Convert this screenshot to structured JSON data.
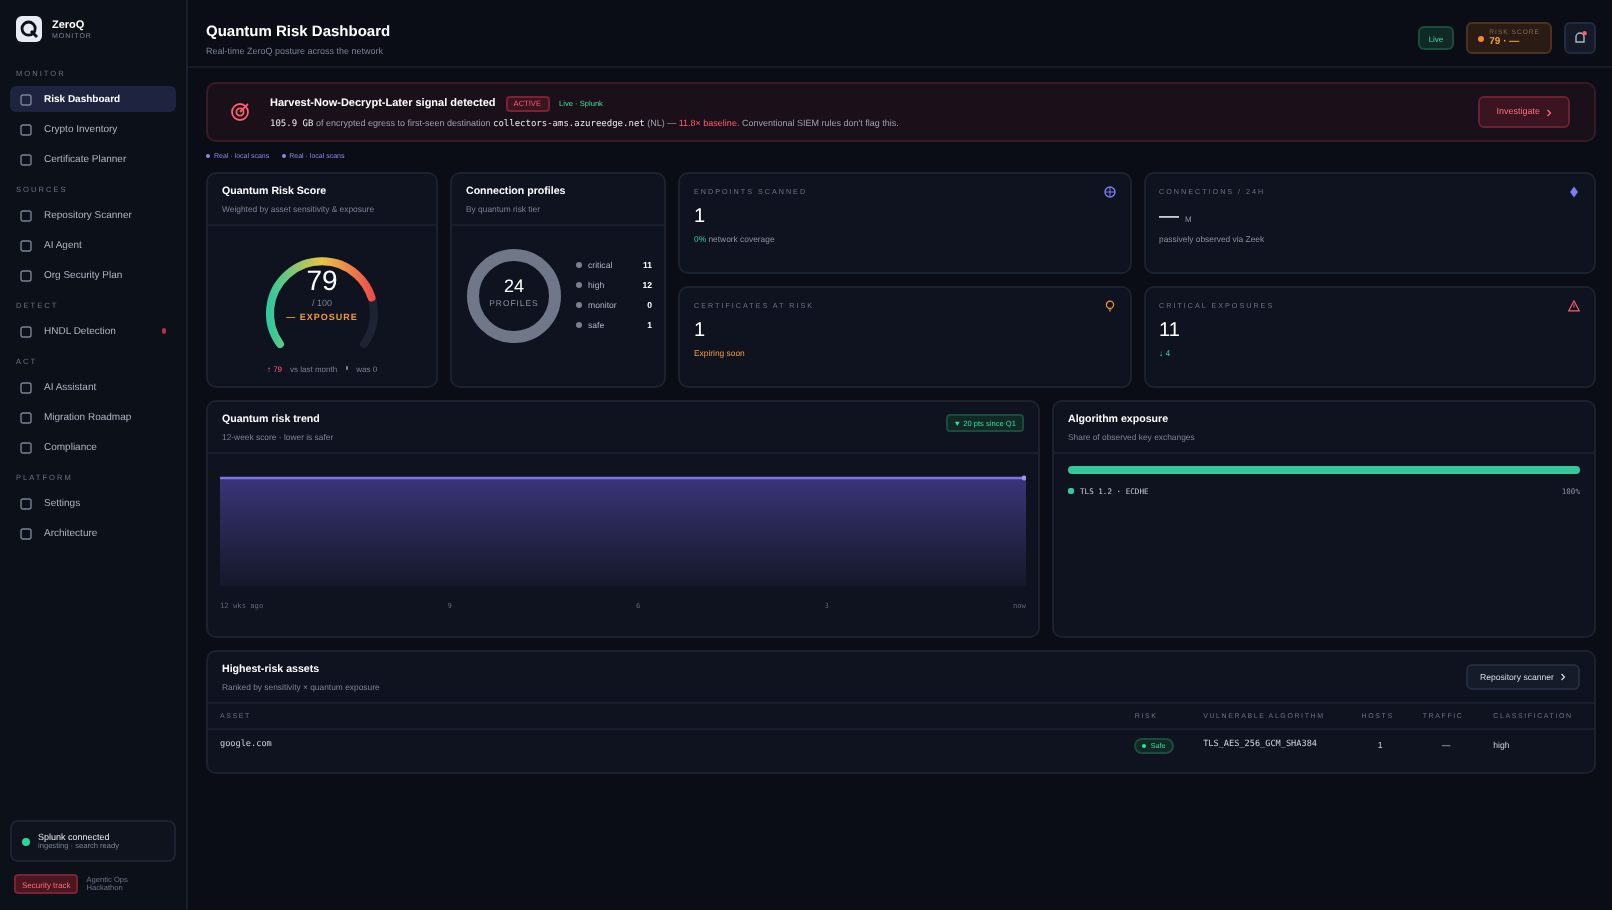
{
  "brand": {
    "name": "ZeroQ",
    "subtitle": "MONITOR"
  },
  "nav_sections": [
    {
      "title": "MONITOR",
      "items": [
        {
          "label": "Risk Dashboard",
          "selected": true,
          "alert": false
        },
        {
          "label": "Crypto Inventory",
          "selected": false,
          "alert": false
        },
        {
          "label": "Certificate Planner",
          "selected": false,
          "alert": false
        }
      ]
    },
    {
      "title": "SOURCES",
      "items": [
        {
          "label": "Repository Scanner",
          "selected": false,
          "alert": false
        },
        {
          "label": "AI Agent",
          "selected": false,
          "alert": false
        },
        {
          "label": "Org Security Plan",
          "selected": false,
          "alert": false
        }
      ]
    },
    {
      "title": "DETECT",
      "items": [
        {
          "label": "HNDL Detection",
          "selected": false,
          "alert": true
        }
      ]
    },
    {
      "title": "ACT",
      "items": [
        {
          "label": "AI Assistant",
          "selected": false,
          "alert": false
        },
        {
          "label": "Migration Roadmap",
          "selected": false,
          "alert": false
        },
        {
          "label": "Compliance",
          "selected": false,
          "alert": false
        }
      ]
    },
    {
      "title": "PLATFORM",
      "items": [
        {
          "label": "Settings",
          "selected": false,
          "alert": false
        },
        {
          "label": "Architecture",
          "selected": false,
          "alert": false
        }
      ]
    }
  ],
  "sidebar_status": {
    "title": "Splunk connected",
    "detail": "ingesting · search ready"
  },
  "sidebar_footer": {
    "badge": "Security track",
    "text": "Agentic Ops Hackathon"
  },
  "header": {
    "title": "Quantum Risk Dashboard",
    "subtitle": "Real-time ZeroQ posture across the network",
    "live": "Live",
    "risk_label": "RISK SCORE",
    "risk_value": "79 · —"
  },
  "alert": {
    "title": "Harvest-Now-Decrypt-Later signal detected",
    "status": "ACTIVE",
    "source": "Live · Splunk",
    "action": "Investigate",
    "message": [
      {
        "text": "105.9 GB",
        "kind": "mono"
      },
      {
        "text": " of encrypted egress to first-seen destination ",
        "kind": "plain"
      },
      {
        "text": "collectors-ams.azureedge.net",
        "kind": "mono"
      },
      {
        "text": " (NL) — ",
        "kind": "plain"
      },
      {
        "text": "11.8× baseline.",
        "kind": "danger"
      },
      {
        "text": " Conventional SIEM rules don't flag this.",
        "kind": "plain"
      }
    ]
  },
  "tags": [
    "Real · local scans",
    "Real · local scans"
  ],
  "risk_score": {
    "title": "Quantum Risk Score",
    "subtitle": "Weighted by asset sensitivity & exposure",
    "value": "79",
    "max": "/ 100",
    "label": "— EXPOSURE",
    "change": "↑ 79",
    "change_text": "vs last month",
    "previous": "was 0"
  },
  "profiles": {
    "title": "Connection profiles",
    "subtitle": "By quantum risk tier",
    "total": "24",
    "total_label": "PROFILES",
    "tiers": [
      {
        "name": "critical",
        "count": "11"
      },
      {
        "name": "high",
        "count": "12"
      },
      {
        "name": "monitor",
        "count": "0"
      },
      {
        "name": "safe",
        "count": "1"
      }
    ]
  },
  "metrics": [
    {
      "label": "ENDPOINTS SCANNED",
      "value": "1",
      "kind": "globe",
      "note": [
        {
          "text": "0%",
          "kind": "good"
        },
        {
          "text": " network coverage",
          "kind": "plain"
        }
      ]
    },
    {
      "label": "CONNECTIONS / 24H",
      "value": "—",
      "unit": "M",
      "kind": "diamond",
      "note": [
        {
          "text": "passively observed via Zeek",
          "kind": "plain"
        }
      ]
    },
    {
      "label": "CERTIFICATES AT RISK",
      "value": "1",
      "kind": "bulb",
      "note": [
        {
          "text": "Expiring soon",
          "kind": "warn"
        }
      ]
    },
    {
      "label": "CRITICAL EXPOSURES",
      "value": "11",
      "kind": "warning",
      "note": [
        {
          "text": "↓ 4",
          "kind": "good"
        }
      ]
    }
  ],
  "trend": {
    "title": "Quantum risk trend",
    "subtitle": "12-week score · lower is safer",
    "badge": "▼ 20 pts since Q1",
    "x_labels": [
      "12 wks ago",
      "9",
      "6",
      "3",
      "now"
    ]
  },
  "algorithms": {
    "title": "Algorithm exposure",
    "subtitle": "Share of observed key exchanges",
    "items": [
      {
        "name": "TLS 1.2 · ECDHE",
        "share": "100%",
        "level": 1,
        "color": "#34c89a"
      }
    ]
  },
  "assets": {
    "title": "Highest-risk assets",
    "subtitle": "Ranked by sensitivity × quantum exposure",
    "action": "Repository scanner",
    "columns": [
      "ASSET",
      "RISK",
      "VULNERABLE ALGORITHM",
      "HOSTS",
      "TRAFFIC",
      "CLASSIFICATION"
    ],
    "rows": [
      {
        "asset": "google.com",
        "risk": "Safe",
        "algorithm": "TLS_AES_256_GCM_SHA384",
        "hosts": "1",
        "traffic": "—",
        "classification": "high"
      }
    ]
  }
}
